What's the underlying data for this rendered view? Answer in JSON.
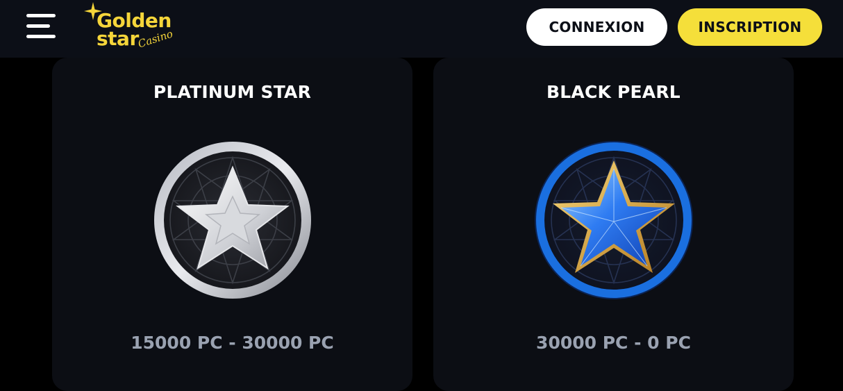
{
  "header": {
    "menu_icon": "hamburger-menu-icon",
    "logo": {
      "word1": "Golden",
      "word2": "star",
      "word3": "Casino",
      "color": "#f5d53a"
    },
    "login_label": "CONNEXION",
    "signup_label": "INSCRIPTION",
    "signup_color": "#f5df3a"
  },
  "levels": [
    {
      "title": "PLATINUM STAR",
      "range": "15000 PC - 30000 PC",
      "badge_icon": "silver-star-badge-icon"
    },
    {
      "title": "BLACK PEARL",
      "range": "30000 PC - 0 PC",
      "badge_icon": "blue-star-badge-icon",
      "ring_color": "#1a6fe0"
    }
  ]
}
